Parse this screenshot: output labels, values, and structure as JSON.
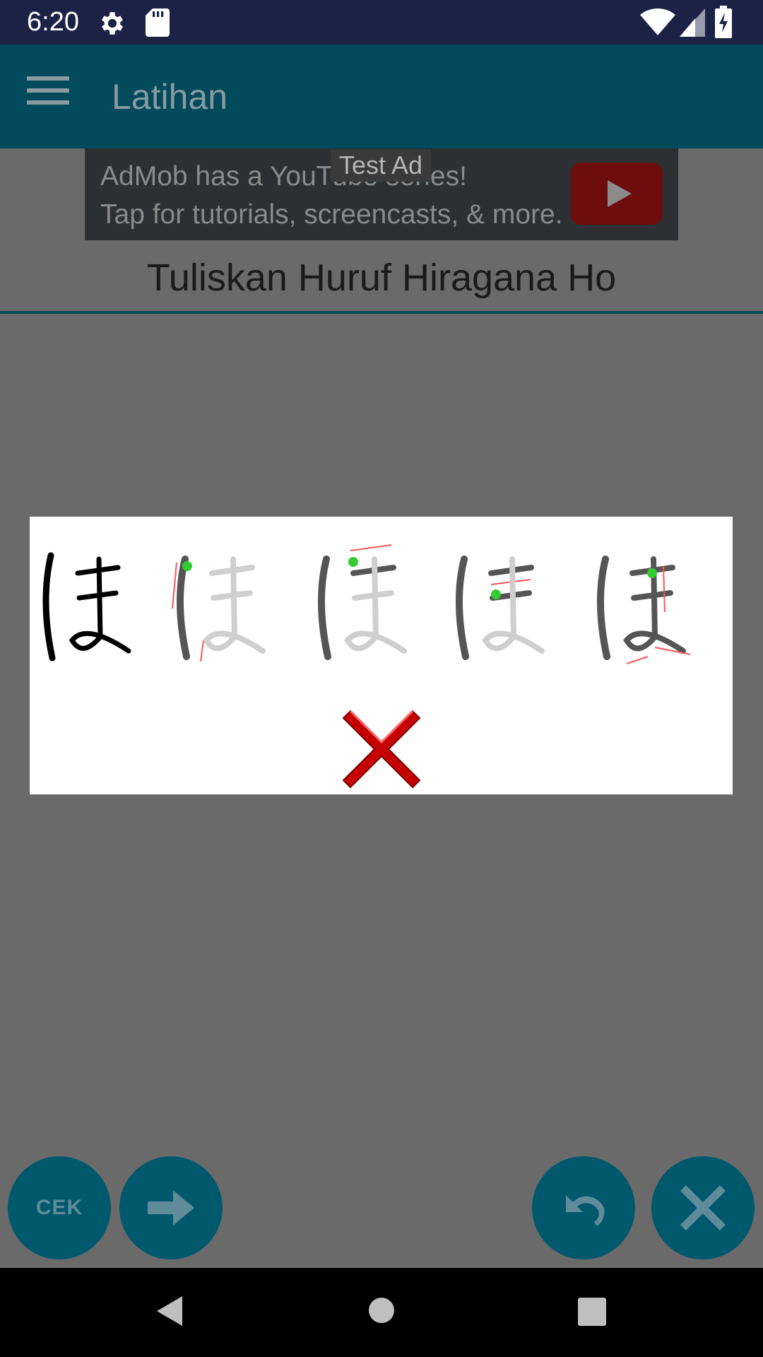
{
  "status_bar": {
    "time": "6:20",
    "icons": [
      "settings-icon",
      "sd-card-icon",
      "wifi-icon",
      "signal-icon",
      "battery-icon"
    ]
  },
  "app_bar": {
    "title": "Latihan",
    "menu_icon": "hamburger-menu-icon"
  },
  "ad": {
    "line1": "AdMob has a YouTube series!",
    "line2": "Tap for tutorials, screencasts, & more.",
    "badge": "Test Ad",
    "play_icon": "youtube-play-icon"
  },
  "instruction": {
    "title": "Tuliskan Huruf Hiragana Ho"
  },
  "dialog": {
    "character": "ほ",
    "result_icon": "wrong-x-icon",
    "colors": {
      "wrong": "#cc0000",
      "stroke_done": "#555555",
      "stroke_pending": "#cfcfcf",
      "stroke_arrow": "#ff5555",
      "stroke_start": "#33cc33"
    }
  },
  "actions": {
    "cek_label": "CEK",
    "next_icon": "arrow-right-icon",
    "undo_icon": "undo-icon",
    "clear_icon": "close-icon"
  },
  "nav": {
    "back": "back-icon",
    "home": "home-icon",
    "recents": "recents-icon"
  },
  "colors": {
    "primary": "#004a5c",
    "fab": "#00586d",
    "status_bar": "#1b2245",
    "scrim": "#6a6a6a"
  }
}
